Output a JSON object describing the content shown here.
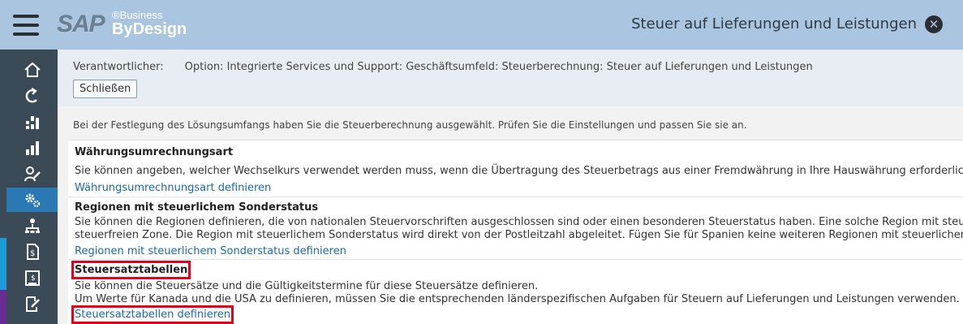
{
  "shell": {
    "logo_text": "SAP",
    "logo_business": "®Business",
    "logo_bydesign": "ByDesign",
    "page_title": "Steuer auf Lieferungen und Leistungen",
    "close_glyph": "✕"
  },
  "sidebar": {
    "items": [
      {
        "icon": "home-icon"
      },
      {
        "icon": "refresh-icon"
      },
      {
        "icon": "dashboard-icon"
      },
      {
        "icon": "bar-chart-icon"
      },
      {
        "icon": "edit-user-icon"
      },
      {
        "icon": "gear-icon",
        "active": true
      },
      {
        "icon": "org-chart-icon"
      },
      {
        "icon": "billing-document-icon"
      },
      {
        "icon": "finance-document-icon"
      },
      {
        "icon": "edit-document-icon"
      }
    ],
    "stripe_colors": [
      "#3b4a57",
      "#1d9bd7",
      "#6a2c91"
    ]
  },
  "header": {
    "responsible_label": "Verantwortlicher:",
    "option_text": "Option:  Integrierte Services und Support: Geschäftsumfeld: Steuerberechnung: Steuer auf Lieferungen und Leistungen",
    "close_button": "Schließen"
  },
  "intro": "Bei der Festlegung des Lösungsumfangs haben Sie die Steuerberechnung ausgewählt. Prüfen Sie die Einstellungen und passen Sie sie an.",
  "sections": [
    {
      "title": "Währungsumrechnungsart",
      "lines": [
        "Sie können angeben, welcher Wechselkurs verwendet werden muss, wenn die Übertragung des Steuerbetrags aus einer Fremdwährung in Ihre Hauswährung erforderlich ist. Die Z"
      ],
      "link": "Währungsumrechnungsart definieren"
    },
    {
      "title": "Regionen mit steuerlichem Sonderstatus",
      "lines": [
        "Sie können die Regionen definieren, die von nationalen Steuervorschriften ausgeschlossen sind oder einen besonderen Steuerstatus haben. Eine solche Region mit steuerlichem S",
        "steuerfreien Zone. Die Region mit steuerlichem Sonderstatus wird direkt von der Postleitzahl abgeleitet. Fügen Sie für Spanien keine weiteren Regionen mit steuerlichem Sonderst"
      ],
      "link": "Regionen mit steuerlichem Sonderstatus definieren"
    },
    {
      "title": "Steuersatztabellen",
      "lines": [
        "Sie können die Steuersätze und die Gültigkeitstermine für diese Steuersätze definieren.",
        "Um Werte für Kanada und die USA zu definieren, müssen Sie die entsprechenden länderspezifischen Aufgaben für Steuern auf Lieferungen und Leistungen verwenden."
      ],
      "link": "Steuersatztabellen definieren"
    }
  ],
  "colors": {
    "shell": "#a9c5df",
    "link": "#1a6aa8",
    "highlight": "#e3001b",
    "active_nav": "#2a79b5"
  }
}
